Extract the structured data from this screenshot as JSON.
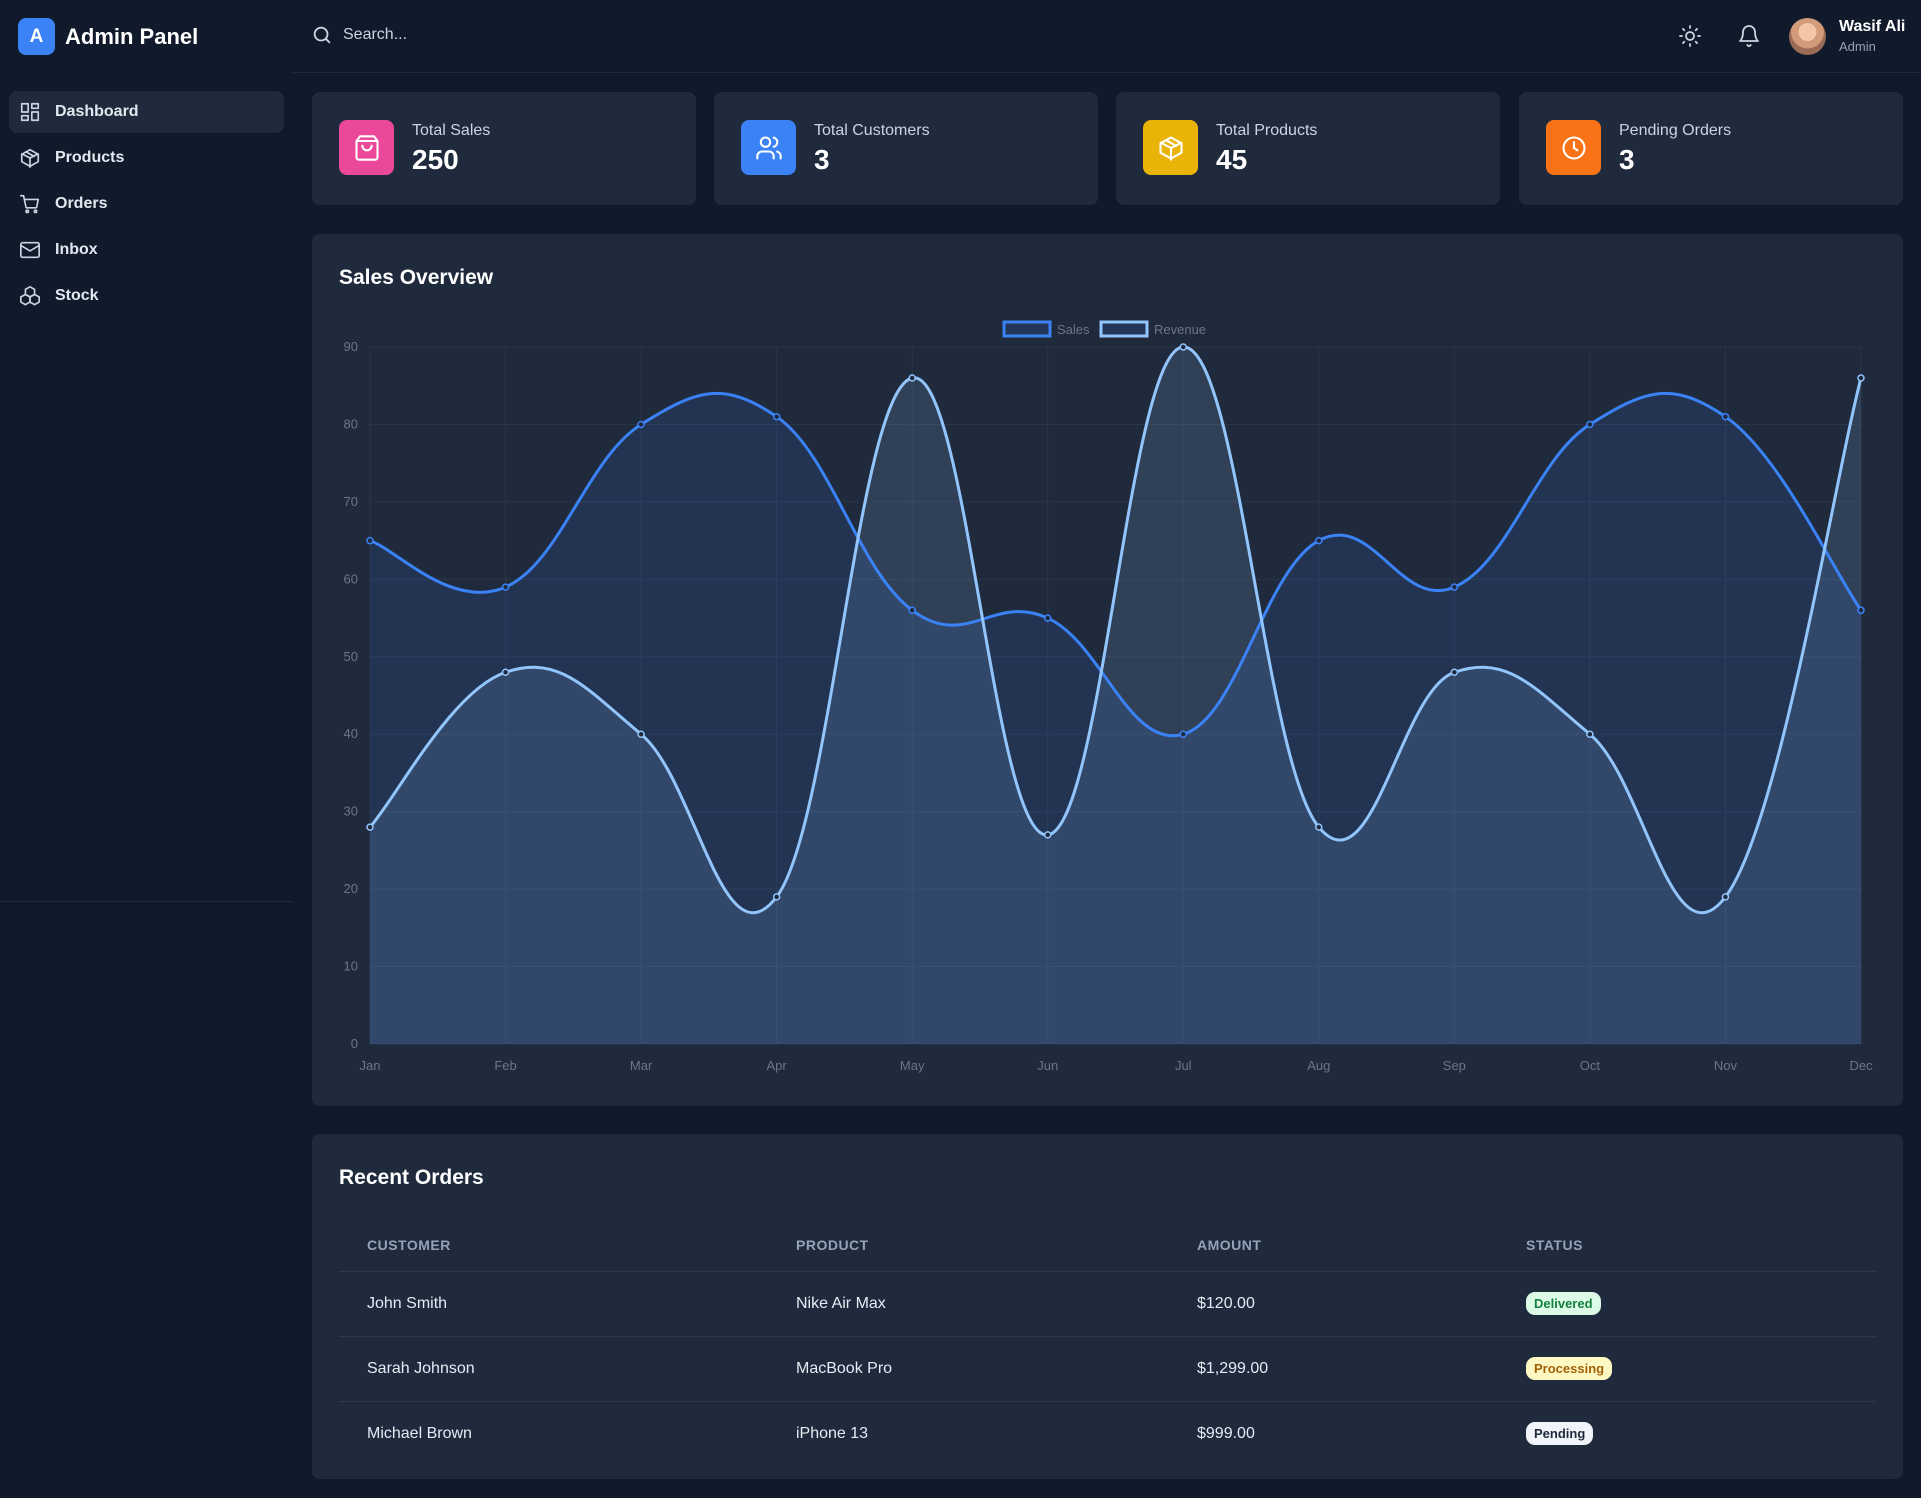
{
  "brand": {
    "logo_letter": "A",
    "title": "Admin Panel"
  },
  "sidebar": {
    "items": [
      {
        "label": "Dashboard",
        "icon": "dashboard-icon",
        "active": true
      },
      {
        "label": "Products",
        "icon": "box-icon",
        "active": false
      },
      {
        "label": "Orders",
        "icon": "cart-icon",
        "active": false
      },
      {
        "label": "Inbox",
        "icon": "mail-icon",
        "active": false
      },
      {
        "label": "Stock",
        "icon": "boxes-icon",
        "active": false
      }
    ]
  },
  "header": {
    "search_placeholder": "Search...",
    "user": {
      "name": "Wasif Ali",
      "role": "Admin"
    }
  },
  "stats": [
    {
      "label": "Total Sales",
      "value": "250",
      "icon": "shopping-bag-icon",
      "color": "#ec4899"
    },
    {
      "label": "Total Customers",
      "value": "3",
      "icon": "users-icon",
      "color": "#3b82f6"
    },
    {
      "label": "Total Products",
      "value": "45",
      "icon": "package-icon",
      "color": "#eab308"
    },
    {
      "label": "Pending Orders",
      "value": "3",
      "icon": "clock-icon",
      "color": "#f97316"
    }
  ],
  "chart_card": {
    "title": "Sales Overview"
  },
  "chart_data": {
    "type": "line",
    "categories": [
      "Jan",
      "Feb",
      "Mar",
      "Apr",
      "May",
      "Jun",
      "Jul",
      "Aug",
      "Sep",
      "Oct",
      "Nov",
      "Dec"
    ],
    "series": [
      {
        "name": "Sales",
        "values": [
          65,
          59,
          80,
          81,
          56,
          55,
          40,
          65,
          59,
          80,
          81,
          56
        ],
        "color": "#3b82f6"
      },
      {
        "name": "Revenue",
        "values": [
          28,
          48,
          40,
          19,
          86,
          27,
          90,
          28,
          48,
          40,
          19,
          86
        ],
        "color": "#93c5fd"
      }
    ],
    "ylim": [
      0,
      90
    ],
    "yticks": [
      0,
      10,
      20,
      30,
      40,
      50,
      60,
      70,
      80,
      90
    ],
    "legend": "top-center",
    "grid": true,
    "filled": true
  },
  "orders": {
    "title": "Recent Orders",
    "columns": [
      "CUSTOMER",
      "PRODUCT",
      "AMOUNT",
      "STATUS"
    ],
    "rows": [
      {
        "customer": "John Smith",
        "product": "Nike Air Max",
        "amount": "$120.00",
        "status": "Delivered"
      },
      {
        "customer": "Sarah Johnson",
        "product": "MacBook Pro",
        "amount": "$1,299.00",
        "status": "Processing"
      },
      {
        "customer": "Michael Brown",
        "product": "iPhone 13",
        "amount": "$999.00",
        "status": "Pending"
      }
    ]
  }
}
